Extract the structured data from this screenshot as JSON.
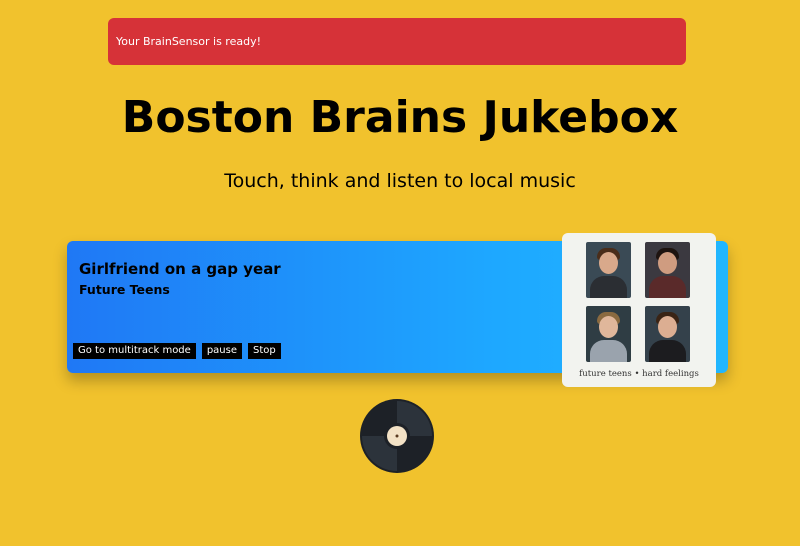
{
  "alert": {
    "message": "Your BrainSensor is ready!"
  },
  "header": {
    "title": "Boston Brains Jukebox",
    "subtitle": "Touch, think and listen to local music"
  },
  "player": {
    "song_title": "Girlfriend on a gap year",
    "artist": "Future Teens",
    "buttons": {
      "multitrack": "Go to multitrack mode",
      "pause": "pause",
      "stop": "Stop"
    },
    "album_caption": "future teens • hard feelings"
  },
  "colors": {
    "background": "#f1c22d",
    "alert": "#d63238",
    "card_gradient_start": "#1f78f5",
    "card_gradient_end": "#21b6fe"
  },
  "icons": {
    "record": "vinyl-record-icon"
  }
}
